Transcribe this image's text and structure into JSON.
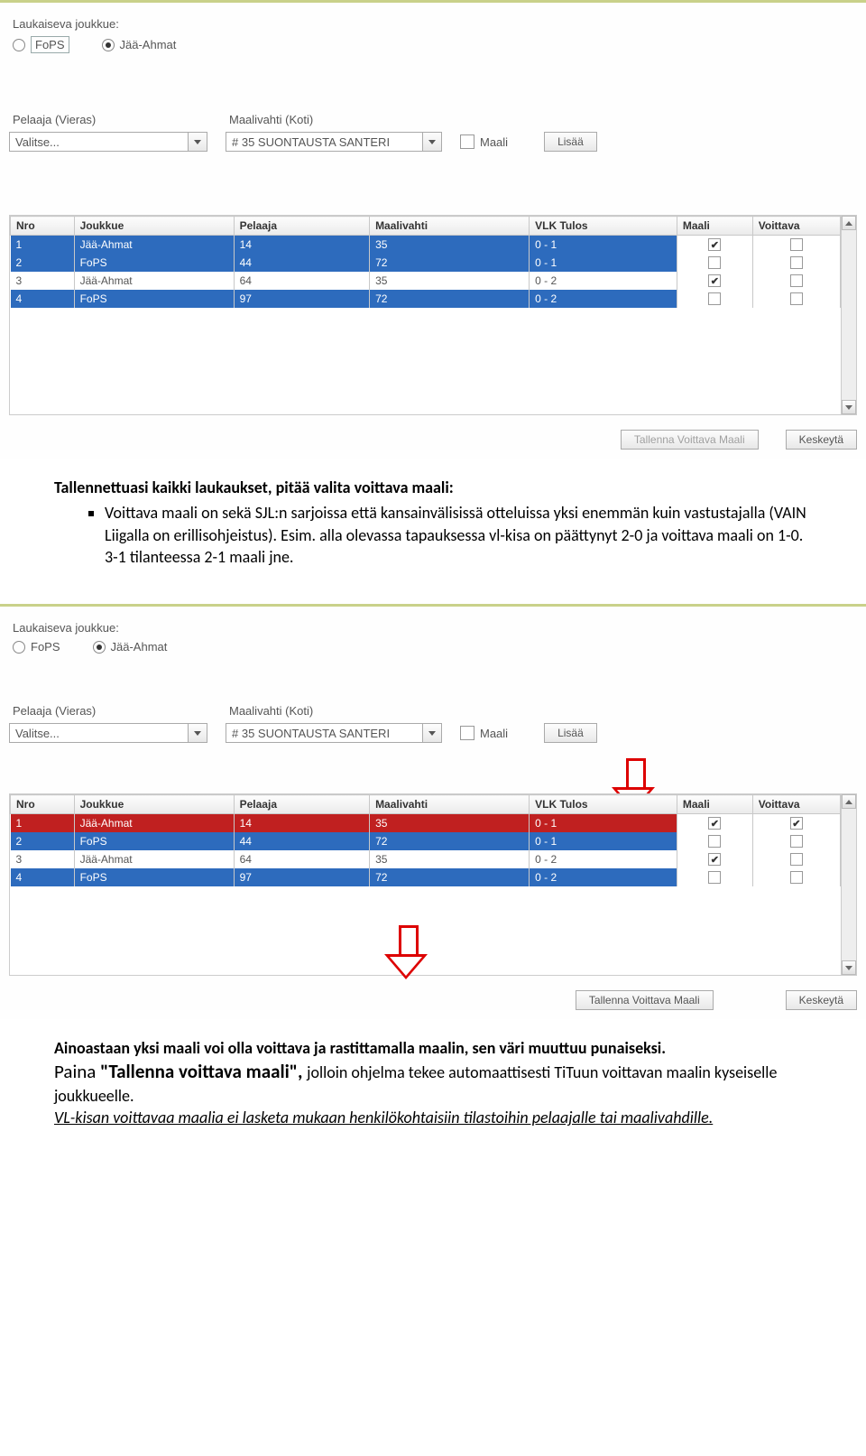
{
  "shot1": {
    "title": "Laukaiseva joukkue:",
    "radios": [
      {
        "label": "FoPS",
        "checked": false,
        "boxed": true
      },
      {
        "label": "Jää-Ahmat",
        "checked": true,
        "boxed": false
      }
    ],
    "playerLabel": "Pelaaja (Vieras)",
    "playerValue": "Valitse...",
    "goalieLabel": "Maalivahti (Koti)",
    "goalieValue": "# 35 SUONTAUSTA SANTERI",
    "goalCheckbox": "Maali",
    "addBtn": "Lisää",
    "headers": [
      "Nro",
      "Joukkue",
      "Pelaaja",
      "Maalivahti",
      "VLK Tulos",
      "Maali",
      "Voittava"
    ],
    "rows": [
      {
        "nro": "1",
        "joukkue": "Jää-Ahmat",
        "pelaaja": "14",
        "mv": "35",
        "tulos": "0 - 1",
        "maali": true,
        "voittava": false,
        "style": "sel"
      },
      {
        "nro": "2",
        "joukkue": "FoPS",
        "pelaaja": "44",
        "mv": "72",
        "tulos": "0 - 1",
        "maali": false,
        "voittava": false,
        "style": "sel"
      },
      {
        "nro": "3",
        "joukkue": "Jää-Ahmat",
        "pelaaja": "64",
        "mv": "35",
        "tulos": "0 - 2",
        "maali": true,
        "voittava": false,
        "style": "alt"
      },
      {
        "nro": "4",
        "joukkue": "FoPS",
        "pelaaja": "97",
        "mv": "72",
        "tulos": "0 - 2",
        "maali": false,
        "voittava": false,
        "style": "sel"
      }
    ],
    "saveBtn": "Tallenna Voittava Maali",
    "cancelBtn": "Keskeytä"
  },
  "doc1": {
    "heading": "Tallennettuasi kaikki laukaukset, pitää valita voittava maali:",
    "bullet": "Voittava maali on sekä SJL:n sarjoissa että kansainvälisissä otteluissa yksi enemmän kuin vastustajalla (VAIN Liigalla on erillisohjeistus). Esim. alla olevassa tapauksessa vl-kisa on päättynyt 2-0 ja voittava maali on 1-0. 3-1 tilanteessa 2-1 maali jne."
  },
  "shot2": {
    "title": "Laukaiseva joukkue:",
    "radios": [
      {
        "label": "FoPS",
        "checked": false,
        "boxed": false
      },
      {
        "label": "Jää-Ahmat",
        "checked": true,
        "boxed": false
      }
    ],
    "playerLabel": "Pelaaja (Vieras)",
    "playerValue": "Valitse...",
    "goalieLabel": "Maalivahti (Koti)",
    "goalieValue": "# 35 SUONTAUSTA SANTERI",
    "goalCheckbox": "Maali",
    "addBtn": "Lisää",
    "headers": [
      "Nro",
      "Joukkue",
      "Pelaaja",
      "Maalivahti",
      "VLK Tulos",
      "Maali",
      "Voittava"
    ],
    "rows": [
      {
        "nro": "1",
        "joukkue": "Jää-Ahmat",
        "pelaaja": "14",
        "mv": "35",
        "tulos": "0 - 1",
        "maali": true,
        "voittava": true,
        "style": "red"
      },
      {
        "nro": "2",
        "joukkue": "FoPS",
        "pelaaja": "44",
        "mv": "72",
        "tulos": "0 - 1",
        "maali": false,
        "voittava": false,
        "style": "sel"
      },
      {
        "nro": "3",
        "joukkue": "Jää-Ahmat",
        "pelaaja": "64",
        "mv": "35",
        "tulos": "0 - 2",
        "maali": true,
        "voittava": false,
        "style": "alt"
      },
      {
        "nro": "4",
        "joukkue": "FoPS",
        "pelaaja": "97",
        "mv": "72",
        "tulos": "0 - 2",
        "maali": false,
        "voittava": false,
        "style": "sel"
      }
    ],
    "saveBtn": "Tallenna Voittava Maali",
    "cancelBtn": "Keskeytä"
  },
  "doc2": {
    "line1": "Ainoastaan yksi maali voi olla voittava ja rastittamalla maalin, sen väri muuttuu punaiseksi.",
    "line2a": "Paina ",
    "line2b": "\"Tallenna voittava maali\", ",
    "line2c": "jolloin ohjelma tekee automaattisesti TiTuun voittavan maalin kyseiselle joukkueelle.",
    "line3": "VL-kisan voittavaa maalia ei lasketa mukaan henkilökohtaisiin tilastoihin pelaajalle tai maalivahdille."
  }
}
